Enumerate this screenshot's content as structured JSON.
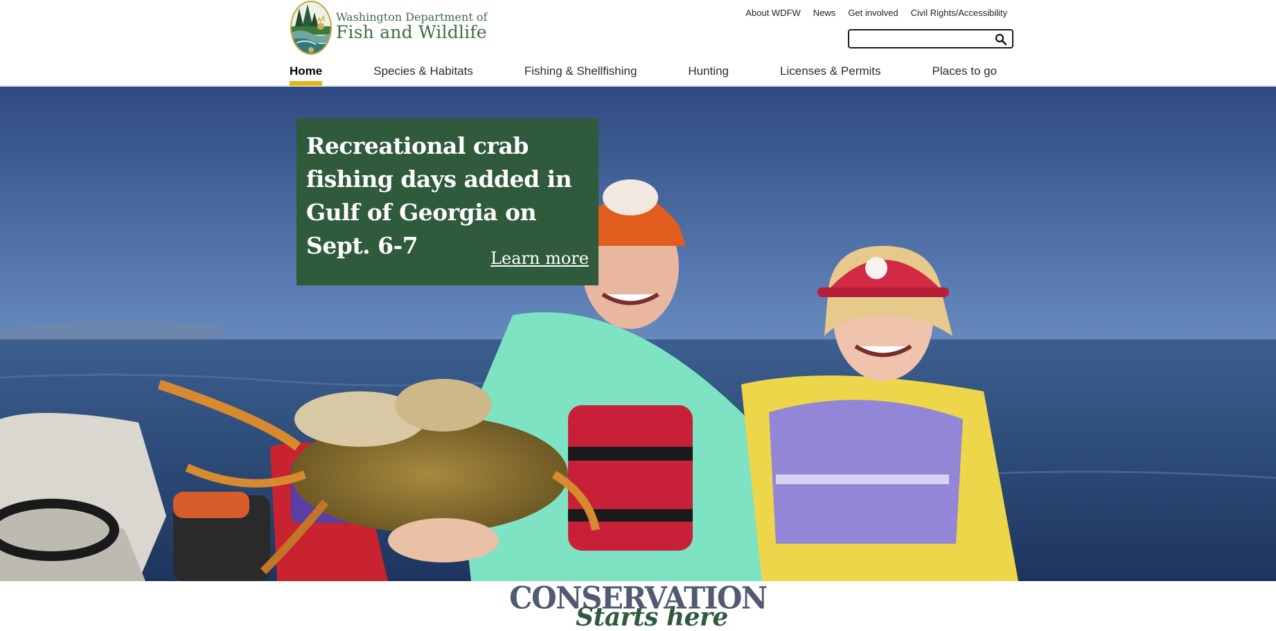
{
  "agency": {
    "line1": "Washington Department of",
    "line2": "Fish and Wildlife",
    "brand_green": "#3d6e3d"
  },
  "utility_nav": [
    {
      "label": "About WDFW"
    },
    {
      "label": "News"
    },
    {
      "label": "Get involved"
    },
    {
      "label": "Civil Rights/Accessibility"
    }
  ],
  "search": {
    "placeholder": "",
    "value": "",
    "icon": "search-icon"
  },
  "main_nav": {
    "items": [
      {
        "label": "Home",
        "active": true
      },
      {
        "label": "Species & Habitats"
      },
      {
        "label": "Fishing & Shellfishing"
      },
      {
        "label": "Hunting"
      },
      {
        "label": "Licenses & Permits"
      },
      {
        "label": "Places to go"
      }
    ],
    "active_indicator_color": "#e3b51b"
  },
  "hero": {
    "headline": "Recreational crab fishing days added in Gulf of Georgia on Sept. 6-7",
    "link_label": "Learn more",
    "panel_color": "#2f5a3b"
  },
  "banner": {
    "line1": "CONSERVATION",
    "line2": "Starts here"
  }
}
